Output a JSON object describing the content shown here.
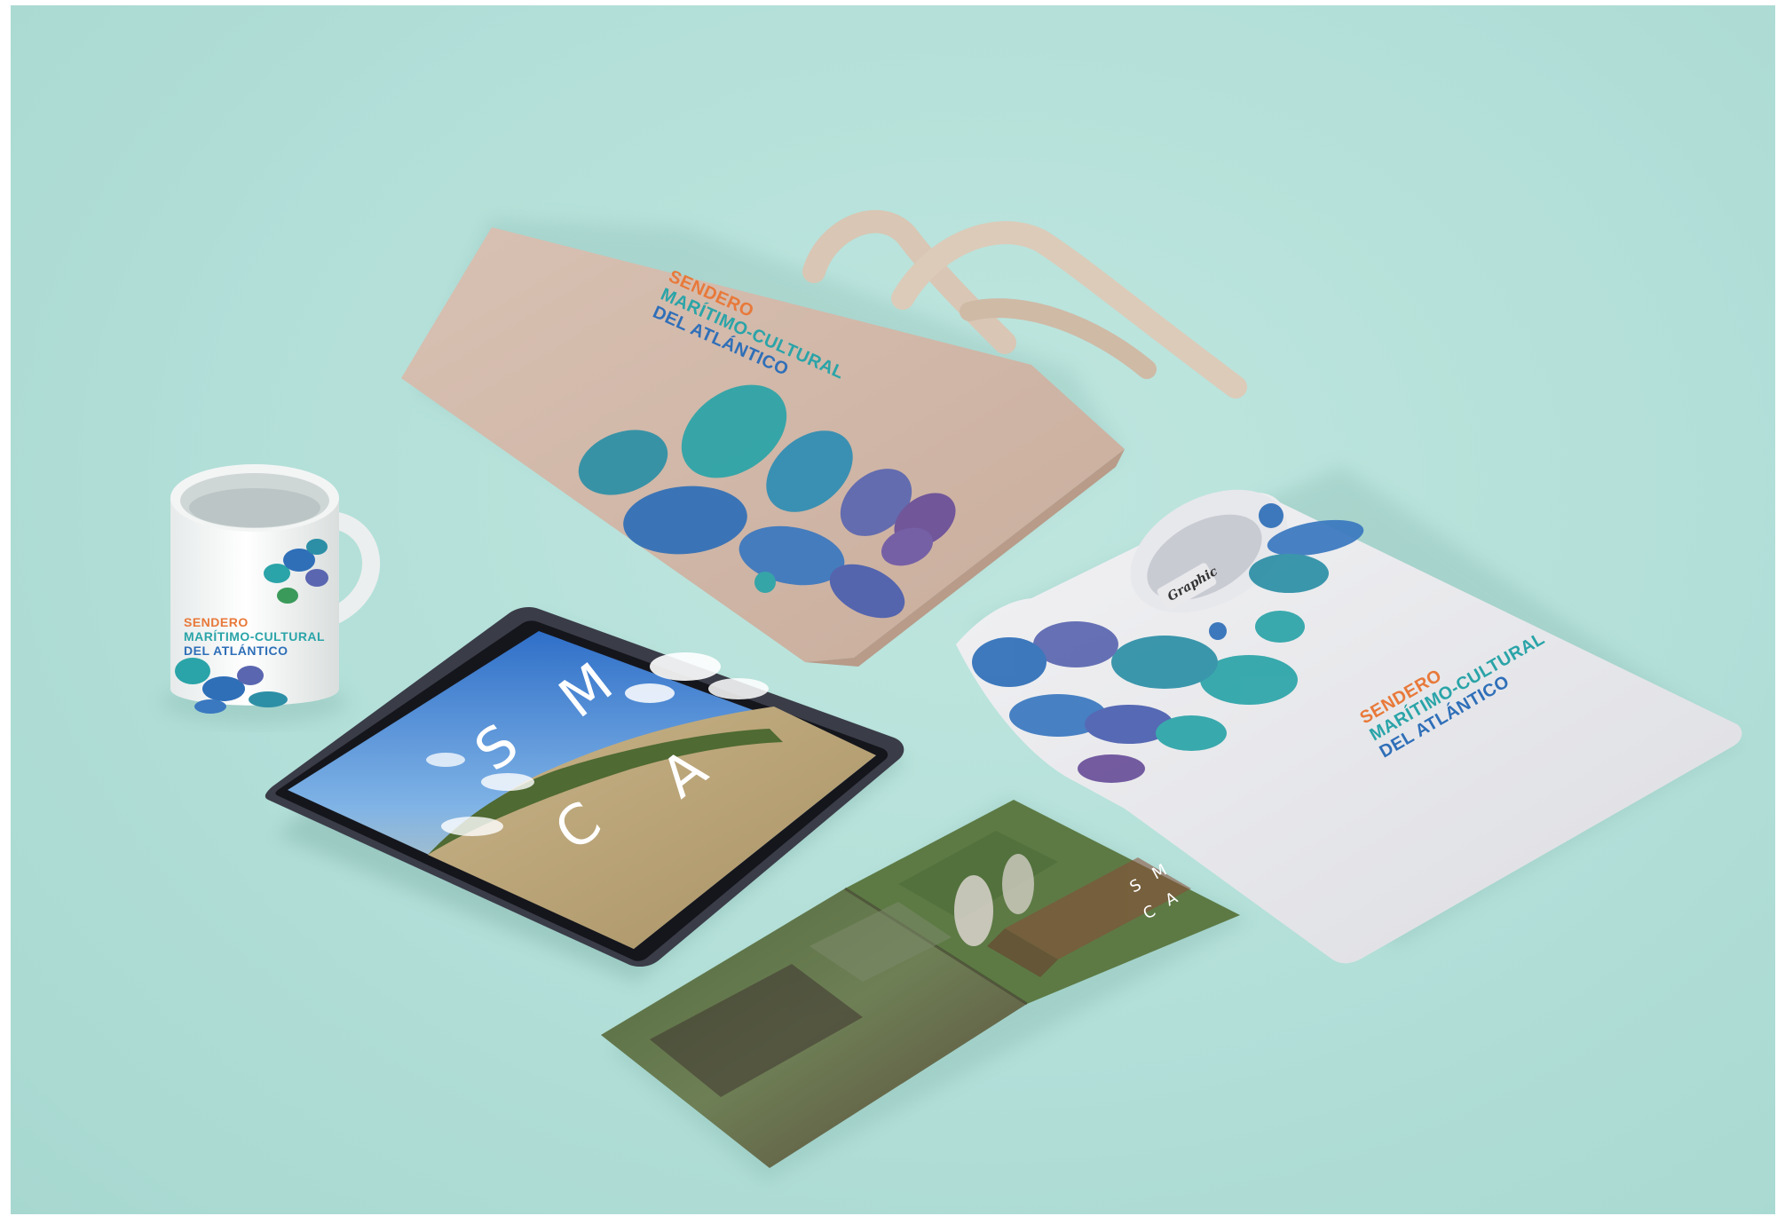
{
  "brand": {
    "line1": "SENDERO",
    "line2": "MARÍTIMO-CULTURAL",
    "line3": "DEL ATLÁNTICO",
    "monogram": [
      "S",
      "M",
      "C",
      "A"
    ]
  },
  "shirt_label": "Graphic",
  "colors": {
    "background": "#b2dfd8",
    "orange": "#e8793a",
    "teal": "#2aa4a8",
    "blue": "#2f6fb8",
    "green": "#3a9a5a",
    "purple": "#6a4f9a"
  }
}
